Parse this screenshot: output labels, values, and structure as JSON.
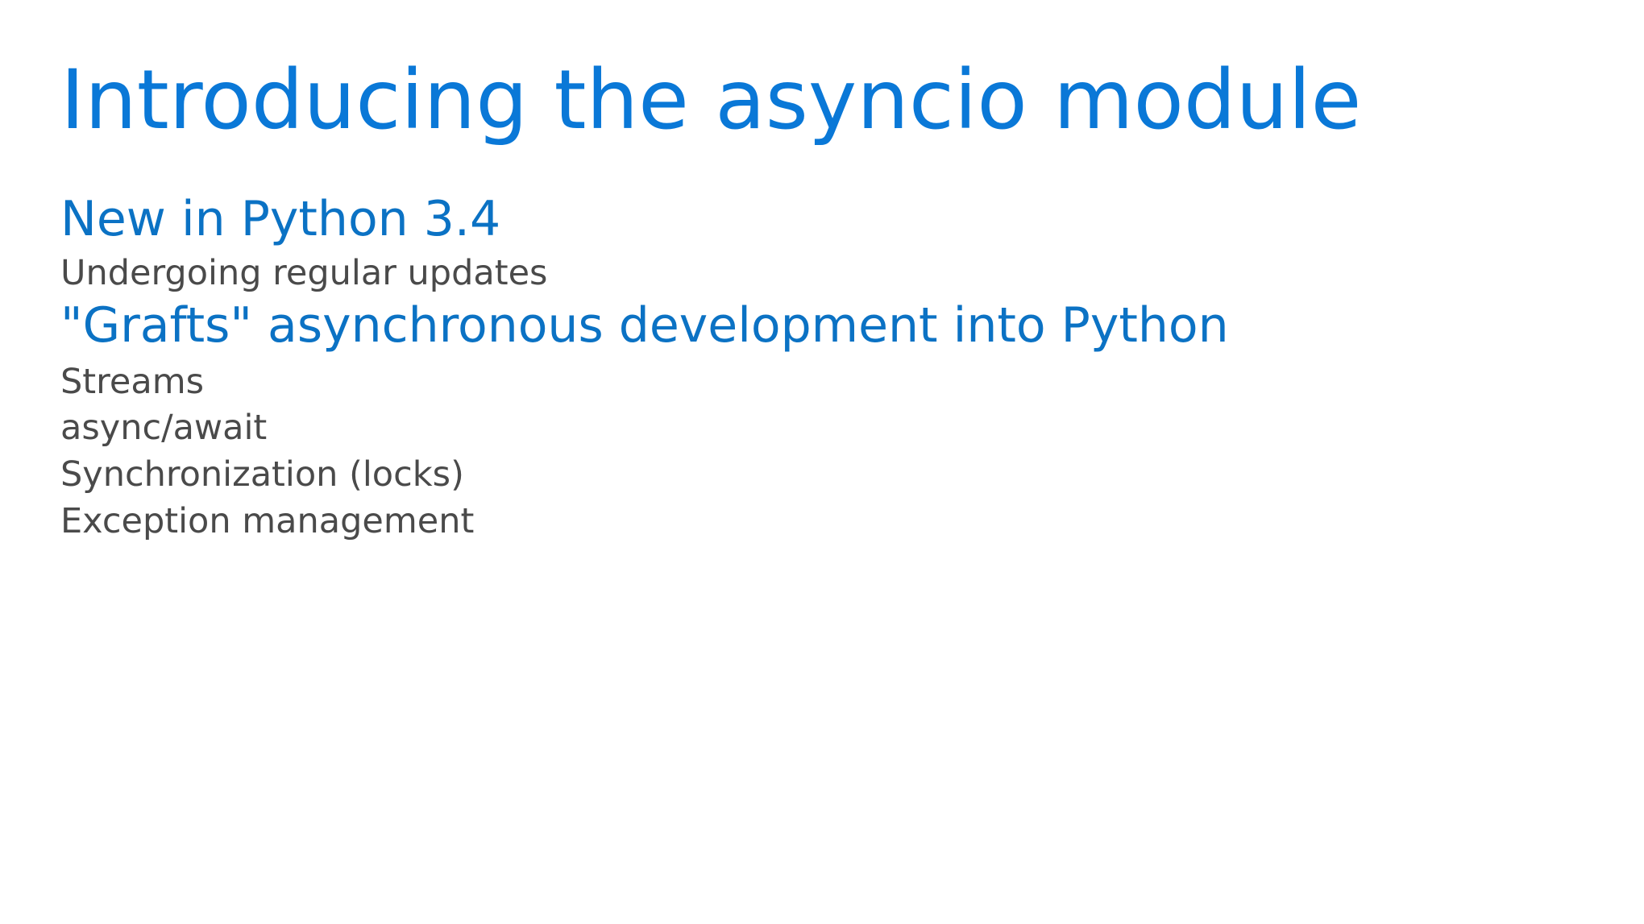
{
  "slide": {
    "title": "Introducing the asyncio module",
    "sections": [
      {
        "heading": "New in Python 3.4",
        "items": [
          "Undergoing regular updates"
        ]
      },
      {
        "heading": "\"Grafts\" asynchronous development into Python",
        "items": [
          "Streams",
          "async/await",
          "Synchronization (locks)",
          "Exception management"
        ]
      }
    ]
  },
  "colors": {
    "title": "#0a78d7",
    "heading": "#0b72c4",
    "body": "#4a4a4a",
    "background": "#ffffff"
  }
}
